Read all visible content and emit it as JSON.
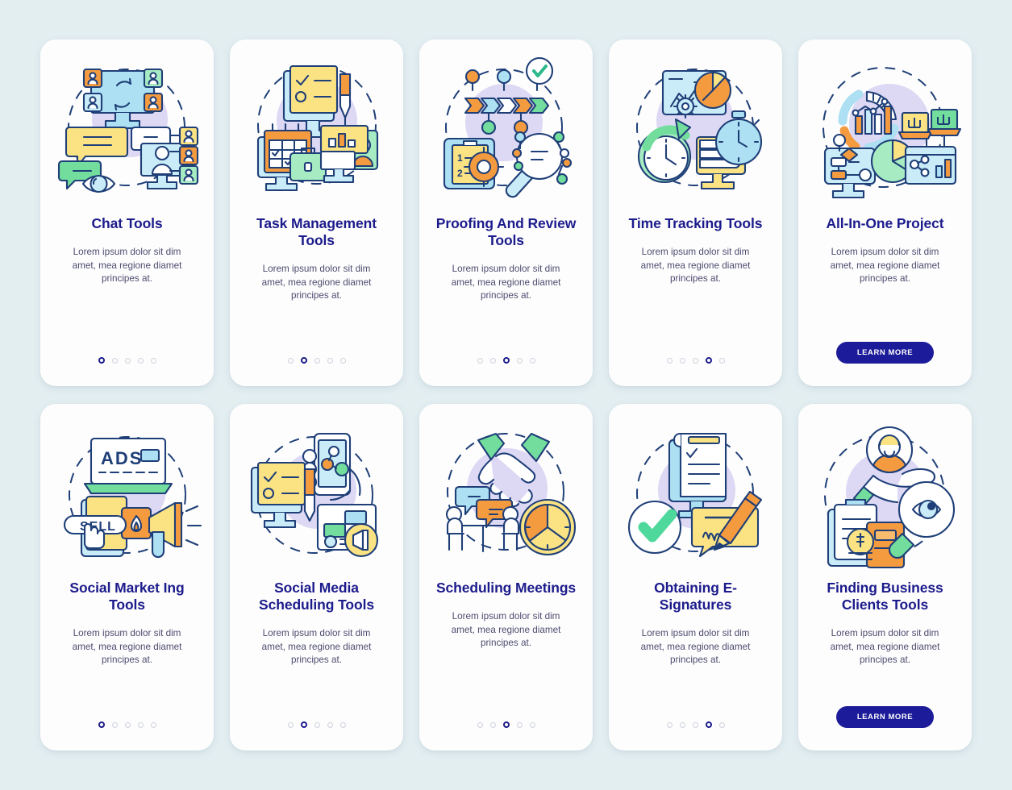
{
  "page": {
    "background_color": "#e3eef1",
    "card_background_color": "#fdfdfd",
    "title_color": "#1c1b8c",
    "body_color": "#4d4c70",
    "accent_color": "#1c1b99",
    "dot_active_color": "#1c1b8c",
    "dot_inactive_color": "#cfd2de"
  },
  "palette": {
    "circle_lilac": "#ddd8f4",
    "cyan": "#ade0f2",
    "cyan_light": "#c9ecf8",
    "yellow": "#fbe383",
    "yellow_light": "#fdf0b7",
    "orange": "#f59b3f",
    "orange_light": "#f9bc6e",
    "green": "#72dd9c",
    "green_light": "#a7ebc2",
    "outline": "#1f3f78",
    "white": "#ffffff"
  },
  "common": {
    "body_text": "Lorem ipsum dolor sit dim amet, mea regione diamet principes at.",
    "learn_more_label": "LEARN MORE",
    "dot_count": 5
  },
  "cards": [
    {
      "id": "chat-tools",
      "title": "Chat Tools",
      "body": "Lorem ipsum dolor sit dim amet, mea regione diamet principes at.",
      "footer_type": "dots",
      "active_dot": 0,
      "illustration": "chat-tools-illustration"
    },
    {
      "id": "task-management-tools",
      "title": "Task Management Tools",
      "body": "Lorem ipsum dolor sit dim amet, mea regione diamet principes at.",
      "footer_type": "dots",
      "active_dot": 1,
      "illustration": "task-management-illustration"
    },
    {
      "id": "proofing-and-review-tools",
      "title": "Proofing And Review Tools",
      "body": "Lorem ipsum dolor sit dim amet, mea regione diamet principes at.",
      "footer_type": "dots",
      "active_dot": 2,
      "illustration": "proofing-review-illustration"
    },
    {
      "id": "time-tracking-tools",
      "title": "Time Tracking Tools",
      "body": "Lorem ipsum dolor sit dim amet, mea regione diamet principes at.",
      "footer_type": "dots",
      "active_dot": 3,
      "illustration": "time-tracking-illustration"
    },
    {
      "id": "all-in-one-project",
      "title": "All-In-One Project",
      "body": "Lorem ipsum dolor sit dim amet, mea regione diamet principes at.",
      "footer_type": "button",
      "button_label": "LEARN MORE",
      "illustration": "all-in-one-illustration"
    },
    {
      "id": "social-marketing-tools",
      "title": "Social Market Ing Tools",
      "body": "Lorem ipsum dolor sit dim amet, mea regione diamet principes at.",
      "footer_type": "dots",
      "active_dot": 0,
      "illustration": "social-marketing-illustration"
    },
    {
      "id": "social-media-scheduling-tools",
      "title": "Social Media Scheduling Tools",
      "body": "Lorem ipsum dolor sit dim amet, mea regione diamet principes at.",
      "footer_type": "dots",
      "active_dot": 1,
      "illustration": "social-media-scheduling-illustration"
    },
    {
      "id": "scheduling-meetings",
      "title": "Scheduling Meetings",
      "body": "Lorem ipsum dolor sit dim amet, mea regione diamet principes at.",
      "footer_type": "dots",
      "active_dot": 2,
      "illustration": "scheduling-meetings-illustration"
    },
    {
      "id": "obtaining-e-signatures",
      "title": "Obtaining E-Signatures",
      "body": "Lorem ipsum dolor sit dim amet, mea regione diamet principes at.",
      "footer_type": "dots",
      "active_dot": 3,
      "illustration": "obtaining-esignatures-illustration"
    },
    {
      "id": "finding-business-clients-tools",
      "title": "Finding Business Clients Tools",
      "body": "Lorem ipsum dolor sit dim amet, mea regione diamet principes at.",
      "footer_type": "button",
      "button_label": "LEARN MORE",
      "illustration": "finding-business-clients-illustration"
    }
  ]
}
